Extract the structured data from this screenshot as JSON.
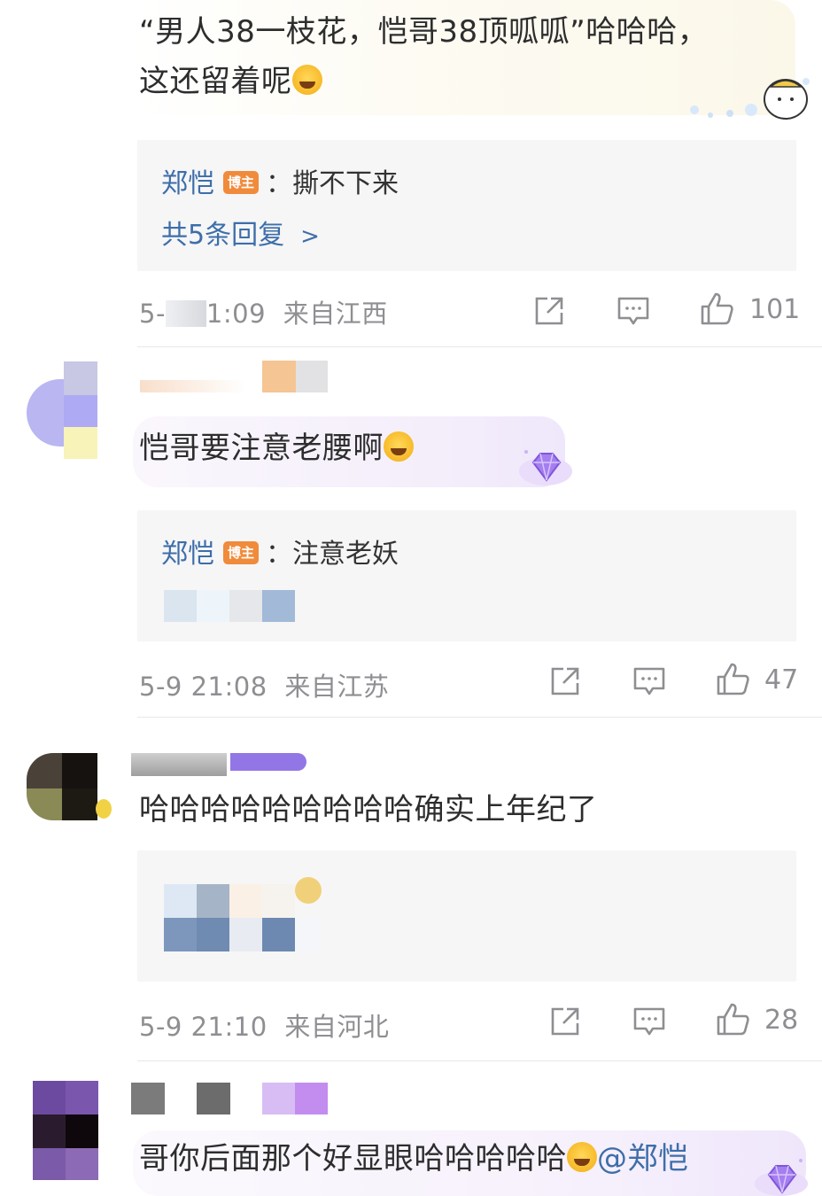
{
  "comments": [
    {
      "text": "“男人38一枝花，恺哥38顶呱呱”哈哈哈，",
      "text_line2": "这还留着呢",
      "reply": {
        "author": "郑恺",
        "author_tag": "博主",
        "separator": "：",
        "content": "撕不下来",
        "more": "共5条回复"
      },
      "time": "5-",
      "time_tail": "1:09",
      "location": "来自江西",
      "likes": "101"
    },
    {
      "text": "恺哥要注意老腰啊",
      "reply": {
        "author": "郑恺",
        "author_tag": "博主",
        "separator": "：",
        "content": "注意老妖"
      },
      "time": "5-9 21:08",
      "location": "来自江苏",
      "likes": "47"
    },
    {
      "text": "哈哈哈哈哈哈哈哈哈确实上年纪了",
      "time": "5-9 21:10",
      "location": "来自河北",
      "likes": "28"
    },
    {
      "text": "哥你后面那个好显眼哈哈哈哈哈",
      "mention": "@郑恺"
    }
  ],
  "icons": {
    "share": "share-icon",
    "comment": "comment-icon",
    "like": "thumbs-up-icon"
  },
  "colors": {
    "link_blue": "#3e6ea9",
    "tag_orange": "#f08b3c",
    "meta_gray": "#8e8e93",
    "reply_bg": "#f6f6f7"
  }
}
